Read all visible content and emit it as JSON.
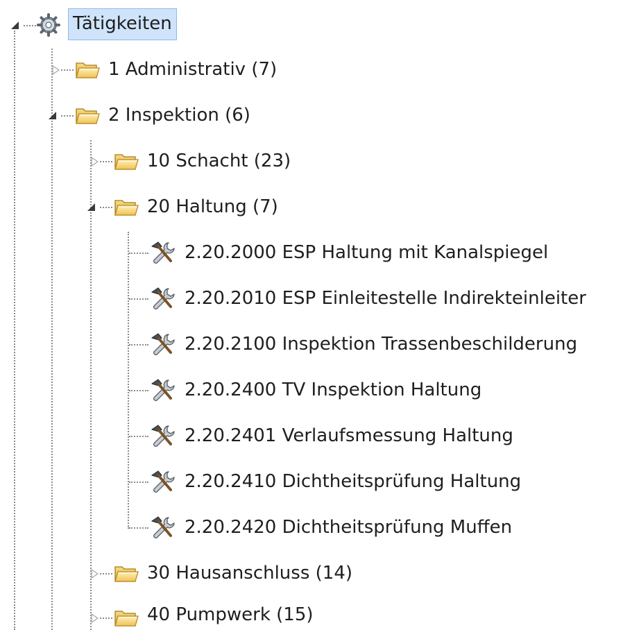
{
  "tree": {
    "root": {
      "label": "Tätigkeiten",
      "icon": "gear-icon",
      "expanded": true,
      "selected": true
    },
    "folders": [
      {
        "label": "1 Administrativ (7)",
        "icon": "folder-icon",
        "expanded": false
      },
      {
        "label": "2 Inspektion (6)",
        "icon": "folder-icon",
        "expanded": true,
        "children": [
          {
            "label": "10 Schacht (23)",
            "icon": "folder-icon",
            "expanded": false
          },
          {
            "label": "20 Haltung (7)",
            "icon": "folder-icon",
            "expanded": true,
            "children": [
              {
                "label": "2.20.2000 ESP Haltung mit Kanalspiegel",
                "icon": "tools-icon"
              },
              {
                "label": "2.20.2010 ESP Einleitestelle Indirekteinleiter",
                "icon": "tools-icon"
              },
              {
                "label": "2.20.2100 Inspektion Trassenbeschilderung",
                "icon": "tools-icon"
              },
              {
                "label": "2.20.2400 TV Inspektion Haltung",
                "icon": "tools-icon"
              },
              {
                "label": "2.20.2401 Verlaufsmessung Haltung",
                "icon": "tools-icon"
              },
              {
                "label": "2.20.2410 Dichtheitsprüfung Haltung",
                "icon": "tools-icon"
              },
              {
                "label": "2.20.2420 Dichtheitsprüfung Muffen",
                "icon": "tools-icon"
              }
            ]
          },
          {
            "label": "30 Hausanschluss (14)",
            "icon": "folder-icon",
            "expanded": false
          },
          {
            "label": "40 Pumpwerk (15)",
            "icon": "folder-icon",
            "expanded": false
          }
        ]
      }
    ]
  }
}
